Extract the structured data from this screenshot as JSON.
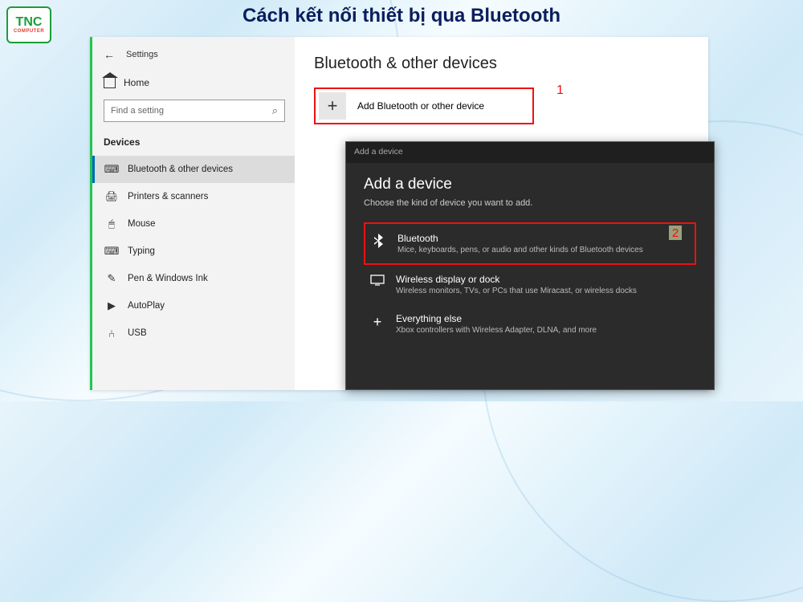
{
  "page_title": "Cách kết nối thiết bị qua Bluetooth",
  "logo": {
    "top": "TNC",
    "bottom": "COMPUTER"
  },
  "annotations": {
    "one": "1",
    "two": "2"
  },
  "settings": {
    "back_aria": "Back",
    "window_title": "Settings",
    "home_label": "Home",
    "search_placeholder": "Find a setting",
    "category_header": "Devices",
    "nav": [
      {
        "icon": "⌨",
        "label": "Bluetooth & other devices",
        "active": true
      },
      {
        "icon": "🖨",
        "label": "Printers & scanners"
      },
      {
        "icon": "🖱",
        "label": "Mouse"
      },
      {
        "icon": "⌨",
        "label": "Typing"
      },
      {
        "icon": "✎",
        "label": "Pen & Windows Ink"
      },
      {
        "icon": "▶",
        "label": "AutoPlay"
      },
      {
        "icon": "⑃",
        "label": "USB"
      }
    ]
  },
  "main": {
    "heading": "Bluetooth & other devices",
    "add_label": "Add Bluetooth or other device"
  },
  "dialog": {
    "titlebar": "Add a device",
    "heading": "Add a device",
    "subheading": "Choose the kind of device you want to add.",
    "options": [
      {
        "icon": "bluetooth",
        "title": "Bluetooth",
        "desc": "Mice, keyboards, pens, or audio and other kinds of Bluetooth devices",
        "highlight": true
      },
      {
        "icon": "display",
        "title": "Wireless display or dock",
        "desc": "Wireless monitors, TVs, or PCs that use Miracast, or wireless docks"
      },
      {
        "icon": "plus",
        "title": "Everything else",
        "desc": "Xbox controllers with Wireless Adapter, DLNA, and more"
      }
    ]
  }
}
